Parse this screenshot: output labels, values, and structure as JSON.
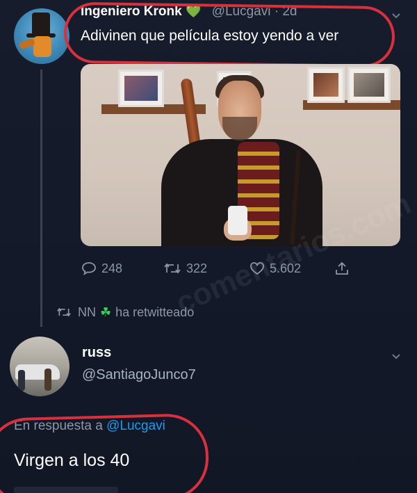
{
  "tweet": {
    "author_name": "Ingeniero Kronk",
    "author_handle": "@Lucgavi · 2d",
    "text": "Adivinen que película estoy yendo a ver",
    "actions": {
      "reply_count": "248",
      "retweet_count": "322",
      "like_count": "5.602"
    }
  },
  "retweet_notice": {
    "user": "NN",
    "text": "ha retwitteado"
  },
  "reply": {
    "author_name": "russ",
    "author_handle": "@SantiagoJunco7",
    "reply_to_prefix": "En respuesta a",
    "reply_to_handle": "@Lucgavi",
    "text": "Virgen a los 40"
  },
  "watermark": "comentarios.com",
  "colors": {
    "background": "#141a2a",
    "highlight_circle": "#d9303e",
    "heart_green": "#3ecf5a",
    "mention_blue": "#1d9bf0",
    "muted": "#8b98a5"
  },
  "icons": [
    "reply-icon",
    "retweet-icon",
    "like-icon",
    "share-icon",
    "chevron-down-icon",
    "green-heart-icon",
    "clover-icon"
  ]
}
